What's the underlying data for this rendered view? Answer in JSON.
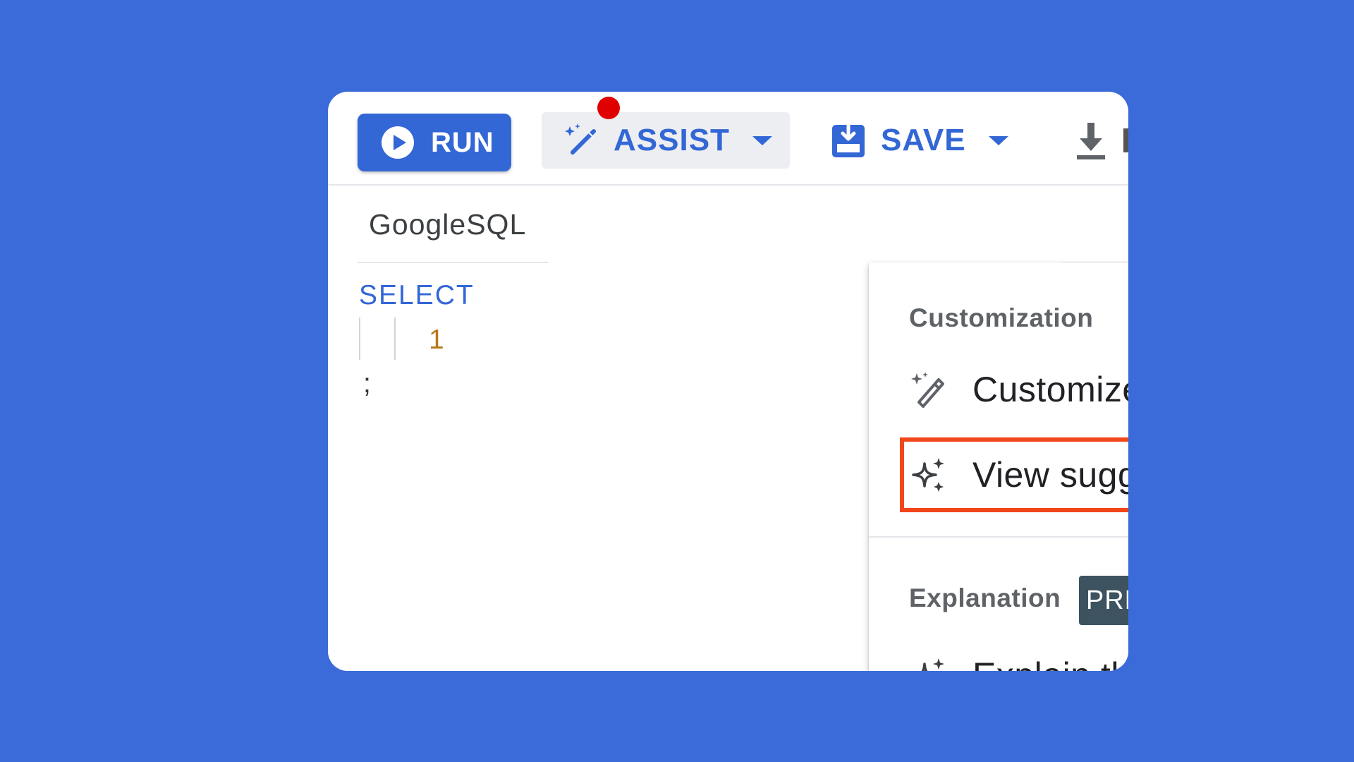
{
  "toolbar": {
    "run_label": "RUN",
    "assist_label": "ASSIST",
    "save_label": "SAVE"
  },
  "editor": {
    "language_tab": "GoogleSQL",
    "code_keyword": "SELECT",
    "code_number": "1",
    "code_semicolon": ";"
  },
  "assist_menu": {
    "customization_heading": "Customization",
    "items": [
      {
        "label": "Customize this translation",
        "icon": "magic-wand-icon"
      },
      {
        "label": "View suggestions",
        "icon": "sparkle-icon",
        "highlighted": true
      }
    ],
    "explanation_heading": "Explanation",
    "preview_badge": "PREVIEW",
    "explain_item": {
      "label": "Explain this translation",
      "icon": "sparkle-icon"
    }
  },
  "colors": {
    "background": "#3b6ad9",
    "primary_blue": "#3367d6",
    "highlight_red": "#f2461b",
    "notification_dot": "#e00000",
    "badge_bg": "#3d5360",
    "code_number": "#b8761a"
  }
}
